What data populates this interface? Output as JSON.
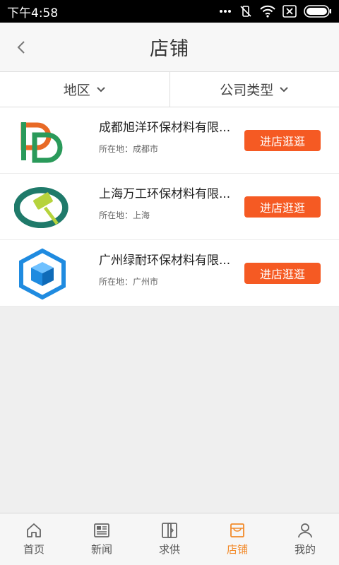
{
  "status_bar": {
    "time": "下午4:58"
  },
  "header": {
    "title": "店铺"
  },
  "filters": [
    {
      "label": "地区"
    },
    {
      "label": "公司类型"
    }
  ],
  "stores": [
    {
      "name": "成都旭洋环保材料有限...",
      "location": "所在地：成都市",
      "button": "进店逛逛",
      "logo_icon": "db-letter-logo-icon"
    },
    {
      "name": "上海万工环保材料有限...",
      "location": "所在地：上海",
      "button": "进店逛逛",
      "logo_icon": "q-roller-logo-icon"
    },
    {
      "name": "广州绿耐环保材料有限...",
      "location": "所在地：广州市",
      "button": "进店逛逛",
      "logo_icon": "blue-cube-hexagon-logo-icon"
    }
  ],
  "tabs": [
    {
      "label": "首页",
      "icon": "home-icon"
    },
    {
      "label": "新闻",
      "icon": "newspaper-icon"
    },
    {
      "label": "求供",
      "icon": "supply-demand-icon"
    },
    {
      "label": "店铺",
      "icon": "store-icon",
      "active": true
    },
    {
      "label": "我的",
      "icon": "user-icon"
    }
  ],
  "colors": {
    "accent": "#f55a23",
    "active_tab": "#f28a2a",
    "status_bar": "#000000"
  }
}
